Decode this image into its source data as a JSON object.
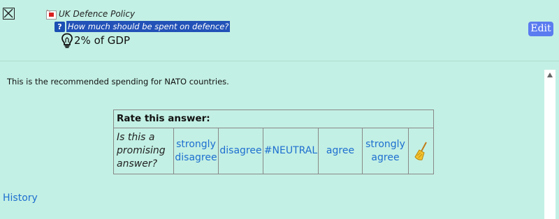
{
  "header": {
    "breadcrumb_label": "UK Defence Policy",
    "question_label": "How much should be spent on defence?",
    "answer_title": "2% of GDP",
    "edit_label": "Edit"
  },
  "body": {
    "description": "This is the recommended spending for NATO countries."
  },
  "rating": {
    "header": "Rate this answer:",
    "prompt_lines": [
      "Is this a",
      "promising",
      "answer?"
    ],
    "options": [
      {
        "lines": [
          "strongly",
          "disagree"
        ]
      },
      {
        "lines": [
          "disagree"
        ]
      },
      {
        "lines": [
          "#NEUTRAL"
        ]
      },
      {
        "lines": [
          "agree"
        ]
      },
      {
        "lines": [
          "strongly",
          "agree"
        ]
      }
    ],
    "clear_icon": "broom-icon"
  },
  "footer": {
    "history_label": "History"
  },
  "icons": {
    "close": "close-icon",
    "breadcrumb": "topic-icon",
    "question": "question-icon",
    "answer": "lightbulb-icon"
  },
  "colors": {
    "background": "#c3f0e4",
    "link": "#1e6fd0",
    "edit_button": "#5b7cf0",
    "question_highlight": "#2252b8"
  }
}
